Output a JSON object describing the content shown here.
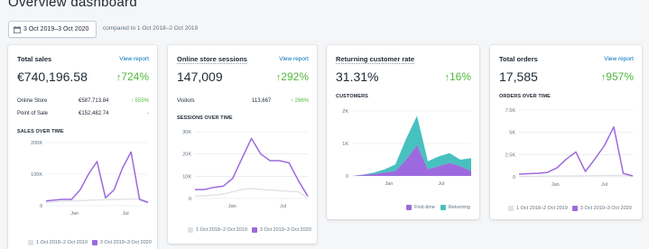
{
  "page": {
    "title": "Overview dashboard"
  },
  "date_picker": {
    "label": "3 Oct 2019–3 Oct 2020",
    "icon": "calendar-icon"
  },
  "compare": {
    "text": "compared to 1 Oct 2018–2 Oct 2019"
  },
  "colors": {
    "current": "#9c6ade",
    "previous": "#dfe3e8",
    "returning": "#47c1bf",
    "positive": "#50b83c",
    "link": "#006fbb"
  },
  "cards": {
    "total_sales": {
      "title": "Total sales",
      "view_report": "View report",
      "value": "€740,196.58",
      "change": "724%",
      "rows": [
        {
          "label": "Online Store",
          "value": "€587,713.84",
          "change": "555%"
        },
        {
          "label": "Point of Sale",
          "value": "€152,482.74",
          "change": "-"
        }
      ],
      "section": "SALES OVER TIME",
      "legend_prev": "1 Oct 2018–2 Oct 2019",
      "legend_curr": "3 Oct 2019–3 Oct 2020"
    },
    "sessions": {
      "title": "Online store sessions",
      "view_report": "View report",
      "value": "147,009",
      "change": "292%",
      "rows": [
        {
          "label": "Visitors",
          "value": "113,667",
          "change": "266%"
        }
      ],
      "section": "SESSIONS OVER TIME",
      "legend_prev": "1 Oct 2018–2 Oct 2019",
      "legend_curr": "3 Oct 2019–3 Oct 2020"
    },
    "returning": {
      "title": "Returning customer rate",
      "value": "31.31%",
      "change": "16%",
      "section": "CUSTOMERS",
      "legend_first": "First-time",
      "legend_returning": "Returning"
    },
    "orders": {
      "title": "Total orders",
      "view_report": "View report",
      "value": "17,585",
      "change": "957%",
      "section": "ORDERS OVER TIME",
      "legend_prev": "1 Oct 2018–2 Oct 2019",
      "legend_curr": "3 Oct 2019–3 Oct 2020"
    }
  },
  "chart_data": [
    {
      "type": "line",
      "id": "sales",
      "x_ticks": [
        "Jan",
        "Jul"
      ],
      "y_ticks": [
        "200K",
        "100K",
        "0"
      ],
      "ylim": [
        0,
        200000
      ],
      "series": [
        {
          "name": "1 Oct 2018–2 Oct 2019",
          "values": [
            10000,
            12000,
            14000,
            15000,
            16000,
            17000,
            18000,
            19000,
            20000,
            20000,
            21000,
            22000,
            12000
          ]
        },
        {
          "name": "3 Oct 2019–3 Oct 2020",
          "values": [
            15000,
            18000,
            20000,
            20000,
            50000,
            100000,
            140000,
            25000,
            50000,
            120000,
            170000,
            20000,
            10000
          ]
        }
      ]
    },
    {
      "type": "line",
      "id": "sessions",
      "x_ticks": [
        "Jan",
        "Jul"
      ],
      "y_ticks": [
        "30K",
        "20K",
        "10K",
        "0"
      ],
      "ylim": [
        0,
        30000
      ],
      "series": [
        {
          "name": "1 Oct 2018–2 Oct 2019",
          "values": [
            1000,
            1200,
            1500,
            2000,
            3000,
            4000,
            4500,
            4000,
            3800,
            3500,
            3200,
            3000,
            200
          ]
        },
        {
          "name": "3 Oct 2019–3 Oct 2020",
          "values": [
            4000,
            4000,
            5000,
            5500,
            9000,
            18000,
            27000,
            20000,
            17000,
            17000,
            16000,
            8000,
            1000
          ]
        }
      ]
    },
    {
      "type": "area",
      "id": "customers",
      "x_ticks": [
        "Jan",
        "Jul"
      ],
      "y_ticks": [
        "2K",
        "1K",
        "0"
      ],
      "ylim": [
        0,
        2000
      ],
      "series": [
        {
          "name": "First-time",
          "values": [
            0,
            30,
            60,
            100,
            150,
            500,
            950,
            200,
            300,
            400,
            300,
            150
          ]
        },
        {
          "name": "Returning",
          "values": [
            0,
            10,
            40,
            100,
            200,
            650,
            900,
            250,
            300,
            300,
            200,
            400
          ]
        }
      ]
    },
    {
      "type": "line",
      "id": "orders",
      "x_ticks": [
        "Jan",
        "Jul"
      ],
      "y_ticks": [
        "7.5K",
        "5K",
        "2.5K",
        "0"
      ],
      "ylim": [
        0,
        7500
      ],
      "series": [
        {
          "name": "1 Oct 2018–2 Oct 2019",
          "values": [
            50,
            60,
            70,
            80,
            90,
            100,
            110,
            120,
            130,
            140,
            150,
            160,
            100
          ]
        },
        {
          "name": "3 Oct 2019–3 Oct 2020",
          "values": [
            300,
            350,
            400,
            500,
            1000,
            2000,
            2800,
            600,
            2000,
            3500,
            5600,
            400,
            100
          ]
        }
      ]
    }
  ]
}
